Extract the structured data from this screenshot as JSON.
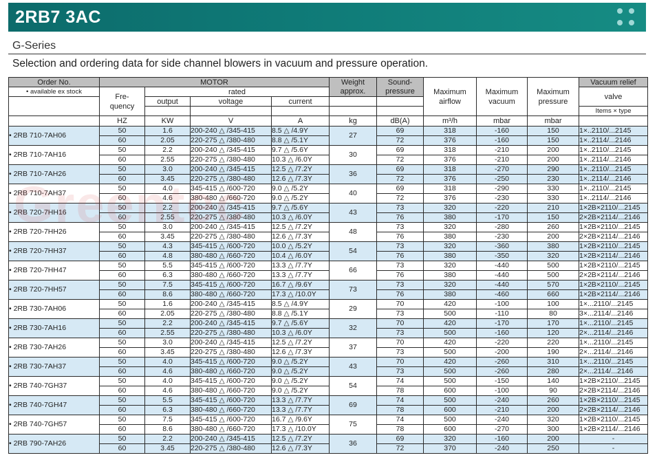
{
  "banner": {
    "title": "2RB7 3AC"
  },
  "series": "G-Series",
  "subtitle": "Selection and ordering data for side channel blowers in vacuum and pressure operation.",
  "watermark": "Greentec",
  "headers": {
    "order_no": "Order No.",
    "available": "• available ex stock",
    "motor": "MOTOR",
    "frequency": "Fre-\nquency",
    "rated": "rated",
    "output": "output",
    "voltage": "voltage",
    "current": "current",
    "weight": "Weight\napprox.",
    "sound": "Sound-\npressure",
    "airflow": "Maximum\nairflow",
    "vacuum": "Maximum\nvacuum",
    "pressure": "Maximum\npressure",
    "vacuum_relief": "Vacuum relief",
    "valve": "valve",
    "items_type": "Items × type"
  },
  "units": [
    "HZ",
    "KW",
    "V",
    "A",
    "kg",
    "dB(A)",
    "m³/h",
    "mbar",
    "mbar"
  ],
  "rows": [
    {
      "model": "• 2RB 710-7AH06",
      "weight": "27",
      "band": "blue",
      "lines": [
        [
          "50",
          "1.6",
          "200-240 △ /345-415",
          "8.5 △ /4.9Y",
          "69",
          "318",
          "-160",
          "150",
          "1×..2110/...2145"
        ],
        [
          "60",
          "2.05",
          "220-275 △ /380-480",
          "8.8 △ /5.1Y",
          "72",
          "376",
          "-160",
          "150",
          "1×..2114/...2146"
        ]
      ]
    },
    {
      "model": "• 2RB 710-7AH16",
      "weight": "30",
      "band": "white",
      "lines": [
        [
          "50",
          "2.2",
          "200-240 △ /345-415",
          "9.7 △ /5.6Y",
          "69",
          "318",
          "-210",
          "200",
          "1×..2110/...2145"
        ],
        [
          "60",
          "2.55",
          "220-275 △ /380-480",
          "10.3 △ /6.0Y",
          "72",
          "376",
          "-210",
          "200",
          "1×..2114/...2146"
        ]
      ]
    },
    {
      "model": "• 2RB 710-7AH26",
      "weight": "36",
      "band": "blue",
      "lines": [
        [
          "50",
          "3.0",
          "200-240 △ /345-415",
          "12.5 △ /7.2Y",
          "69",
          "318",
          "-270",
          "290",
          "1×..2110/...2145"
        ],
        [
          "60",
          "3.45",
          "220-275 △ /380-480",
          "12.6 △ /7.3Y",
          "72",
          "376",
          "-250",
          "230",
          "1×..2114/...2146"
        ]
      ]
    },
    {
      "model": "• 2RB 710-7AH37",
      "weight": "40",
      "band": "white",
      "lines": [
        [
          "50",
          "4.0",
          "345-415 △ /600-720",
          "9.0 △ /5.2Y",
          "69",
          "318",
          "-290",
          "330",
          "1×..2110/...2145"
        ],
        [
          "60",
          "4.6",
          "380-480 △ /660-720",
          "9.0 △ /5.2Y",
          "72",
          "376",
          "-230",
          "330",
          "1×..2114/...2146"
        ]
      ]
    },
    {
      "model": "• 2RB 720-7HH16",
      "weight": "43",
      "band": "blue",
      "lines": [
        [
          "50",
          "2.2",
          "200-240 △ /345-415",
          "9.7 △ /5.6Y",
          "73",
          "320",
          "-220",
          "210",
          "1×2B×2110/...2145"
        ],
        [
          "60",
          "2.55",
          "220-275 △ /380-480",
          "10.3 △ /6.0Y",
          "76",
          "380",
          "-170",
          "150",
          "2×2B×2114/...2146"
        ]
      ]
    },
    {
      "model": "• 2RB 720-7HH26",
      "weight": "48",
      "band": "white",
      "lines": [
        [
          "50",
          "3.0",
          "200-240 △ /345-415",
          "12.5 △ /7.2Y",
          "73",
          "320",
          "-280",
          "260",
          "1×2B×2110/...2145"
        ],
        [
          "60",
          "3.45",
          "220-275 △ /380-480",
          "12.6 △ /7.3Y",
          "76",
          "380",
          "-230",
          "200",
          "2×2B×2114/...2146"
        ]
      ]
    },
    {
      "model": "• 2RB 720-7HH37",
      "weight": "54",
      "band": "blue",
      "lines": [
        [
          "50",
          "4.3",
          "345-415 △ /600-720",
          "10.0 △ /5.2Y",
          "73",
          "320",
          "-360",
          "380",
          "1×2B×2110/...2145"
        ],
        [
          "60",
          "4.8",
          "380-480 △ /660-720",
          "10.4 △ /6.0Y",
          "76",
          "380",
          "-350",
          "320",
          "1×2B×2114/...2146"
        ]
      ]
    },
    {
      "model": "• 2RB 720-7HH47",
      "weight": "66",
      "band": "white",
      "lines": [
        [
          "50",
          "5.5",
          "345-415 △ /600-720",
          "13.3 △ /7.7Y",
          "73",
          "320",
          "-440",
          "500",
          "1×2B×2110/...2145"
        ],
        [
          "60",
          "6.3",
          "380-480 △ /660-720",
          "13.3 △ /7.7Y",
          "76",
          "380",
          "-440",
          "500",
          "2×2B×2114/...2146"
        ]
      ]
    },
    {
      "model": "• 2RB 720-7HH57",
      "weight": "73",
      "band": "blue",
      "lines": [
        [
          "50",
          "7.5",
          "345-415 △ /600-720",
          "16.7 △ /9.6Y",
          "73",
          "320",
          "-440",
          "570",
          "1×2B×2110/...2145"
        ],
        [
          "60",
          "8.6",
          "380-480 △ /660-720",
          "17.3 △ /10.0Y",
          "76",
          "380",
          "-460",
          "660",
          "1×2B×2114/...2146"
        ]
      ]
    },
    {
      "model": "• 2RB 730-7AH06",
      "weight": "29",
      "band": "white",
      "lines": [
        [
          "50",
          "1.6",
          "200-240 △ /345-415",
          "8.5 △ /4.9Y",
          "70",
          "420",
          "-100",
          "100",
          "1×...2110/...2145"
        ],
        [
          "60",
          "2.05",
          "220-275 △ /380-480",
          "8.8 △ /5.1Y",
          "73",
          "500",
          "-110",
          "80",
          "3×...2114/...2146"
        ]
      ]
    },
    {
      "model": "• 2RB 730-7AH16",
      "weight": "32",
      "band": "blue",
      "lines": [
        [
          "50",
          "2.2",
          "200-240 △ /345-415",
          "9.7 △ /5.6Y",
          "70",
          "420",
          "-170",
          "170",
          "1×...2110/...2145"
        ],
        [
          "60",
          "2.55",
          "220-275 △ /380-480",
          "10.3 △ /6.0Y",
          "73",
          "500",
          "-160",
          "120",
          "2×...2114/...2146"
        ]
      ]
    },
    {
      "model": "• 2RB 730-7AH26",
      "weight": "37",
      "band": "white",
      "lines": [
        [
          "50",
          "3.0",
          "200-240 △ /345-415",
          "12.5 △ /7.2Y",
          "70",
          "420",
          "-220",
          "220",
          "1×...2110/...2145"
        ],
        [
          "60",
          "3.45",
          "220-275 △ /380-480",
          "12.6 △ /7.3Y",
          "73",
          "500",
          "-200",
          "190",
          "2×...2114/...2146"
        ]
      ]
    },
    {
      "model": "• 2RB 730-7AH37",
      "weight": "43",
      "band": "blue",
      "lines": [
        [
          "50",
          "4.0",
          "345-415 △ /600-720",
          "9.0 △ /5.2Y",
          "70",
          "420",
          "-260",
          "310",
          "1×...2110/...2145"
        ],
        [
          "60",
          "4.6",
          "380-480 △ /660-720",
          "9.0 △ /5.2Y",
          "73",
          "500",
          "-260",
          "280",
          "2×...2114/...2146"
        ]
      ]
    },
    {
      "model": "• 2RB 740-7GH37",
      "weight": "54",
      "band": "white",
      "lines": [
        [
          "50",
          "4.0",
          "345-415 △ /600-720",
          "9.0 △ /5.2Y",
          "74",
          "500",
          "-150",
          "140",
          "1×2B×2110/...2145"
        ],
        [
          "60",
          "4.6",
          "380-480 △ /660-720",
          "9.0 △ /5.2Y",
          "78",
          "600",
          "-100",
          "90",
          "2×2B×2114/...2146"
        ]
      ]
    },
    {
      "model": "• 2RB 740-7GH47",
      "weight": "69",
      "band": "blue",
      "lines": [
        [
          "50",
          "5.5",
          "345-415 △ /600-720",
          "13.3 △ /7.7Y",
          "74",
          "500",
          "-240",
          "260",
          "1×2B×2110/...2145"
        ],
        [
          "60",
          "6.3",
          "380-480 △ /660-720",
          "13.3 △ /7.7Y",
          "78",
          "600",
          "-210",
          "200",
          "2×2B×2114/...2146"
        ]
      ]
    },
    {
      "model": "• 2RB 740-7GH57",
      "weight": "75",
      "band": "white",
      "lines": [
        [
          "50",
          "7.5",
          "345-415 △ /600-720",
          "16.7 △ /9.6Y",
          "74",
          "500",
          "-240",
          "320",
          "1×2B×2110/...2145"
        ],
        [
          "60",
          "8.6",
          "380-480 △ /660-720",
          "17.3 △ /10.0Y",
          "78",
          "600",
          "-270",
          "300",
          "1×2B×2114/...2146"
        ]
      ]
    },
    {
      "model": "• 2RB 790-7AH26",
      "weight": "36",
      "band": "blue",
      "lines": [
        [
          "50",
          "2.2",
          "200-240 △ /345-415",
          "12.5 △ /7.2Y",
          "69",
          "320",
          "-160",
          "200",
          "-"
        ],
        [
          "60",
          "3.45",
          "220-275 △ /380-480",
          "12.6 △ /7.3Y",
          "72",
          "370",
          "-240",
          "250",
          "-"
        ]
      ]
    }
  ]
}
